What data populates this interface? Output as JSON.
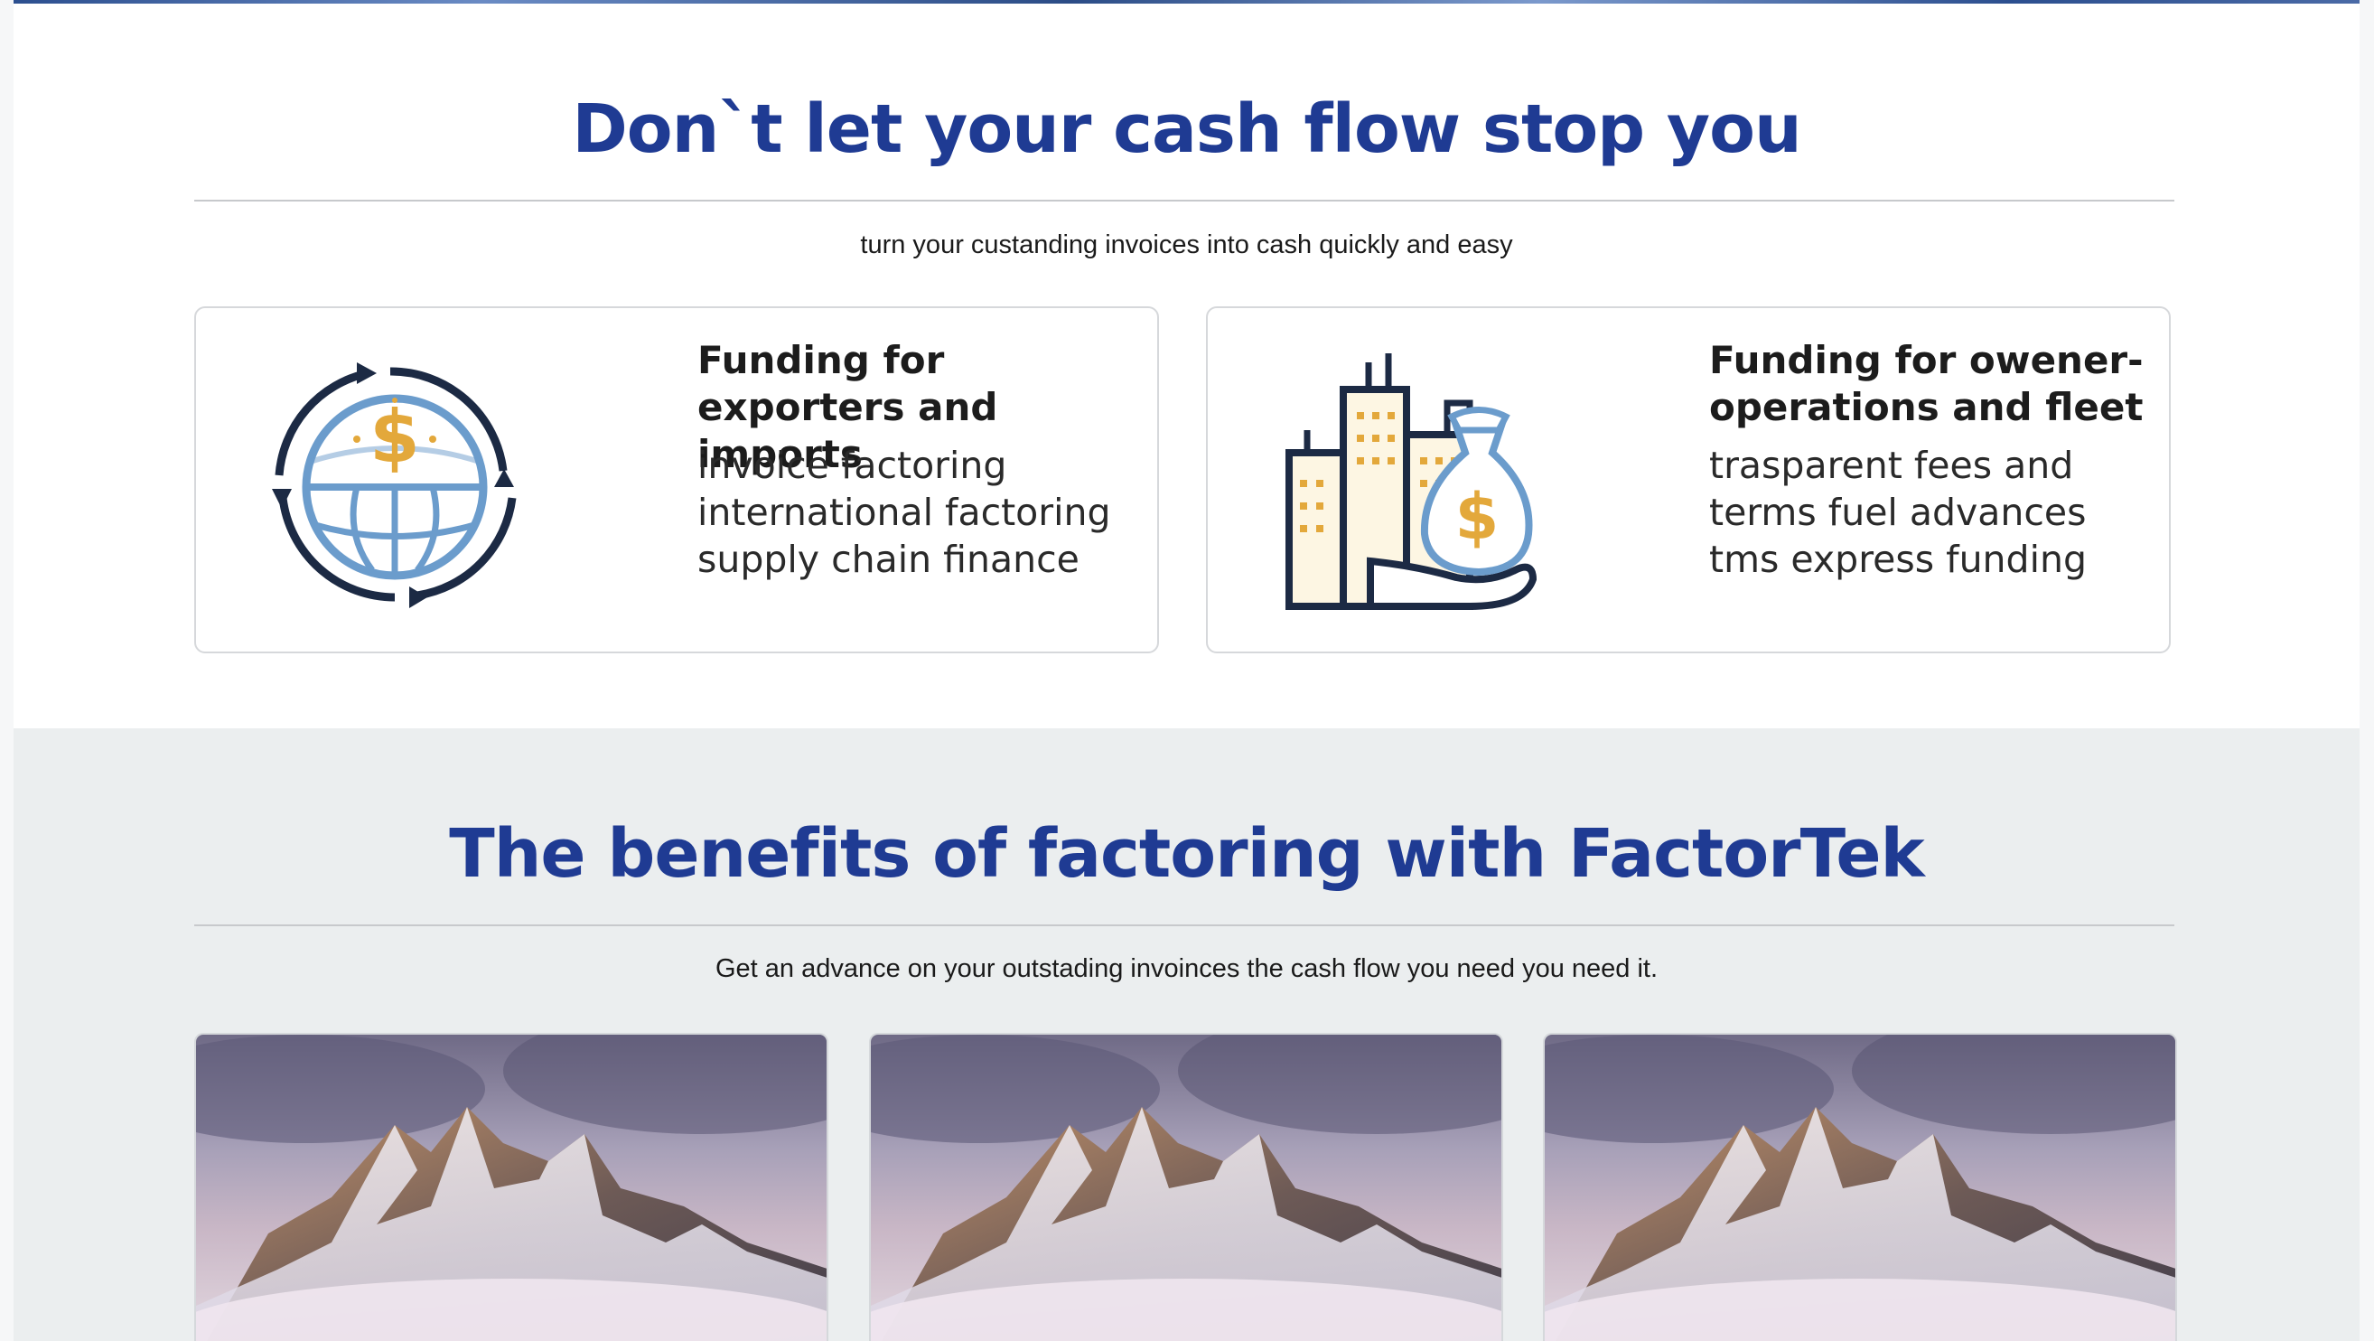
{
  "cashflow": {
    "heading": "Don`t let your cash flow stop you",
    "subtitle": "turn your custanding invoices into cash quickly and easy",
    "cards": [
      {
        "title": "Funding for exporters and imports",
        "text": "invoice factoring international factoring supply chain finance",
        "icon": "globe-dollar-icon"
      },
      {
        "title": "Funding for owener-operations and fleet",
        "text": "trasparent fees and terms fuel advances tms express funding",
        "icon": "city-money-bag-icon"
      }
    ]
  },
  "benefits": {
    "heading": "The benefits of factoring with FactorTek",
    "subtitle": "Get an advance on your outstading invoinces the cash flow you need you need it.",
    "images": [
      {
        "name": "mountain-photo"
      },
      {
        "name": "mountain-photo"
      },
      {
        "name": "mountain-photo"
      }
    ]
  },
  "colors": {
    "heading": "#1f3b93",
    "section_bg": "#ebeeef",
    "card_border": "#d6d8db"
  }
}
